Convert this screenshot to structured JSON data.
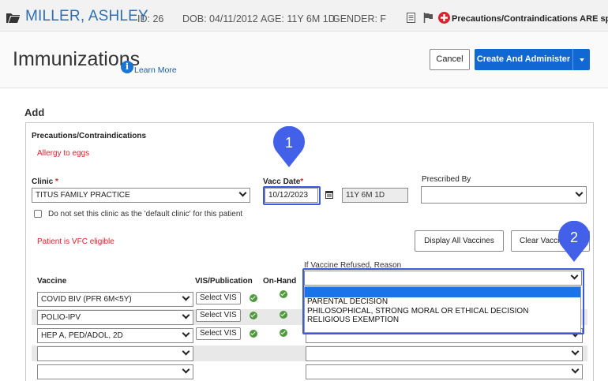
{
  "patient": {
    "name": "MILLER, ASHLEY",
    "id": "ID: 26",
    "dob": "DOB: 04/11/2012",
    "age": "AGE: 11Y 6M 1D",
    "gender": "GENDER: F",
    "precaution_notice": "Precautions/Contraindications ARE specified"
  },
  "title_bar": {
    "title": "Immunizations",
    "learn_more": "Learn More",
    "cancel_label": "Cancel",
    "create_label": "Create And Administer"
  },
  "form": {
    "add_heading": "Add",
    "precautions_heading": "Precautions/Contraindications",
    "allergy": "Allergy to eggs",
    "clinic_label": "Clinic",
    "clinic_value": "TITUS FAMILY PRACTICE",
    "default_clinic_text": "Do not set this clinic as the 'default clinic' for this patient",
    "vacc_date_label": "Vacc Date",
    "vacc_date_value": "10/12/2023",
    "age_at_vacc": "11Y 6M 1D",
    "prescribed_by_label": "Prescribed By",
    "prescribed_by_value": "",
    "vfc_text": "Patient is VFC eligible",
    "display_all_label": "Display All Vaccines",
    "clear_label": "Clear Vacci",
    "refused_reason_label": "If Vaccine Refused, Reason",
    "required_mark": "*"
  },
  "table": {
    "columns": {
      "vaccine": "Vaccine",
      "vis": "VIS/Publication",
      "onhand": "On-Hand"
    },
    "select_vis_label": "Select VIS",
    "rows": [
      {
        "vaccine": "COVID BIV (PFR 6M<5Y)"
      },
      {
        "vaccine": "POLIO-IPV"
      },
      {
        "vaccine": "HEP A, PED/ADOL, 2D"
      },
      {
        "vaccine": ""
      },
      {
        "vaccine": ""
      }
    ]
  },
  "refused_options": [
    "PARENTAL DECISION",
    "PHILOSOPHICAL, STRONG MORAL OR ETHICAL DECISION",
    "RELIGIOUS EXEMPTION"
  ],
  "callouts": [
    "1",
    "2"
  ],
  "colors": {
    "brand_blue": "#1268d2",
    "annotation_blue": "#3b5bdb",
    "error_red": "#d9232e",
    "ok_green": "#4f9a3c"
  }
}
